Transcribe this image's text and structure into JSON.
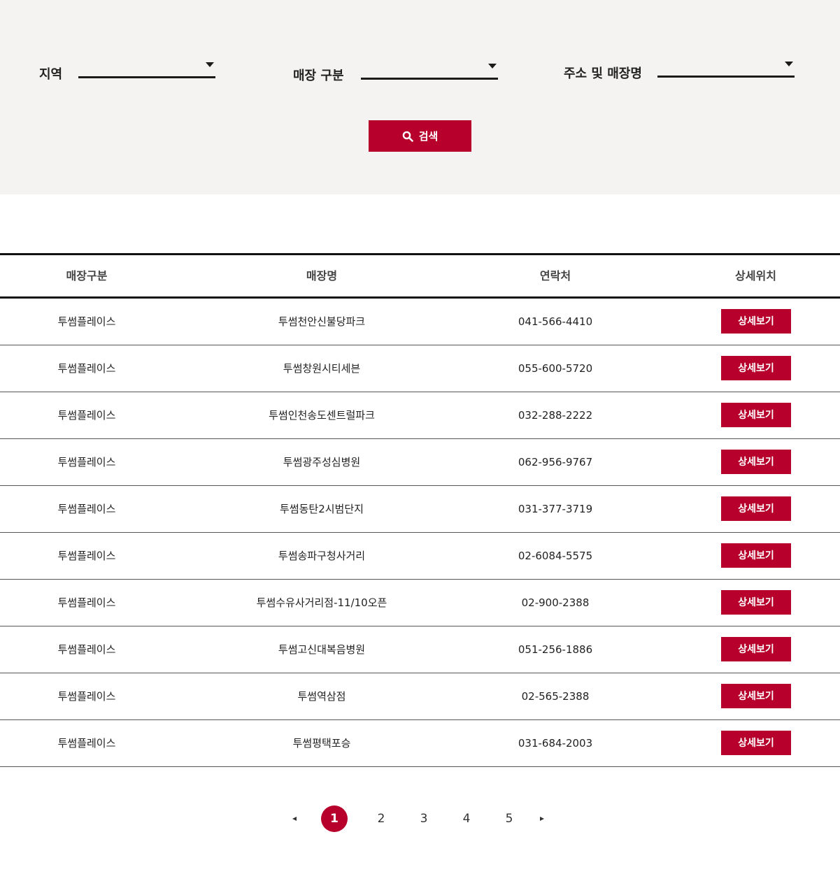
{
  "filters": {
    "region_label": "지역",
    "store_type_label": "매장 구분",
    "address_label": "주소 및 매장명",
    "search_label": "검색"
  },
  "table": {
    "headers": [
      "매장구분",
      "매장명",
      "연락처",
      "상세위치"
    ],
    "rows": [
      {
        "type": "투썸플레이스",
        "name": "투썸천안신불당파크",
        "phone": "041-566-4410",
        "detail": "상세보기"
      },
      {
        "type": "투썸플레이스",
        "name": "투썸창원시티세븐",
        "phone": "055-600-5720",
        "detail": "상세보기"
      },
      {
        "type": "투썸플레이스",
        "name": "투썸인천송도센트럴파크",
        "phone": "032-288-2222",
        "detail": "상세보기"
      },
      {
        "type": "투썸플레이스",
        "name": "투썸광주성심병원",
        "phone": "062-956-9767",
        "detail": "상세보기"
      },
      {
        "type": "투썸플레이스",
        "name": "투썸동탄2시범단지",
        "phone": "031-377-3719",
        "detail": "상세보기"
      },
      {
        "type": "투썸플레이스",
        "name": "투썸송파구청사거리",
        "phone": "02-6084-5575",
        "detail": "상세보기"
      },
      {
        "type": "투썸플레이스",
        "name": "투썸수유사거리점-11/10오픈",
        "phone": "02-900-2388",
        "detail": "상세보기"
      },
      {
        "type": "투썸플레이스",
        "name": "투썸고신대복음병원",
        "phone": "051-256-1886",
        "detail": "상세보기"
      },
      {
        "type": "투썸플레이스",
        "name": "투썸역삼점",
        "phone": "02-565-2388",
        "detail": "상세보기"
      },
      {
        "type": "투썸플레이스",
        "name": "투썸평택포승",
        "phone": "031-684-2003",
        "detail": "상세보기"
      }
    ]
  },
  "pagination": {
    "pages": [
      "1",
      "2",
      "3",
      "4",
      "5"
    ],
    "current": "1",
    "prev_icon": "triangle-left-icon",
    "next_icon": "triangle-right-icon"
  },
  "colors": {
    "accent": "#b7002b",
    "panel_bg": "#f4f3f1",
    "text": "#222222"
  }
}
